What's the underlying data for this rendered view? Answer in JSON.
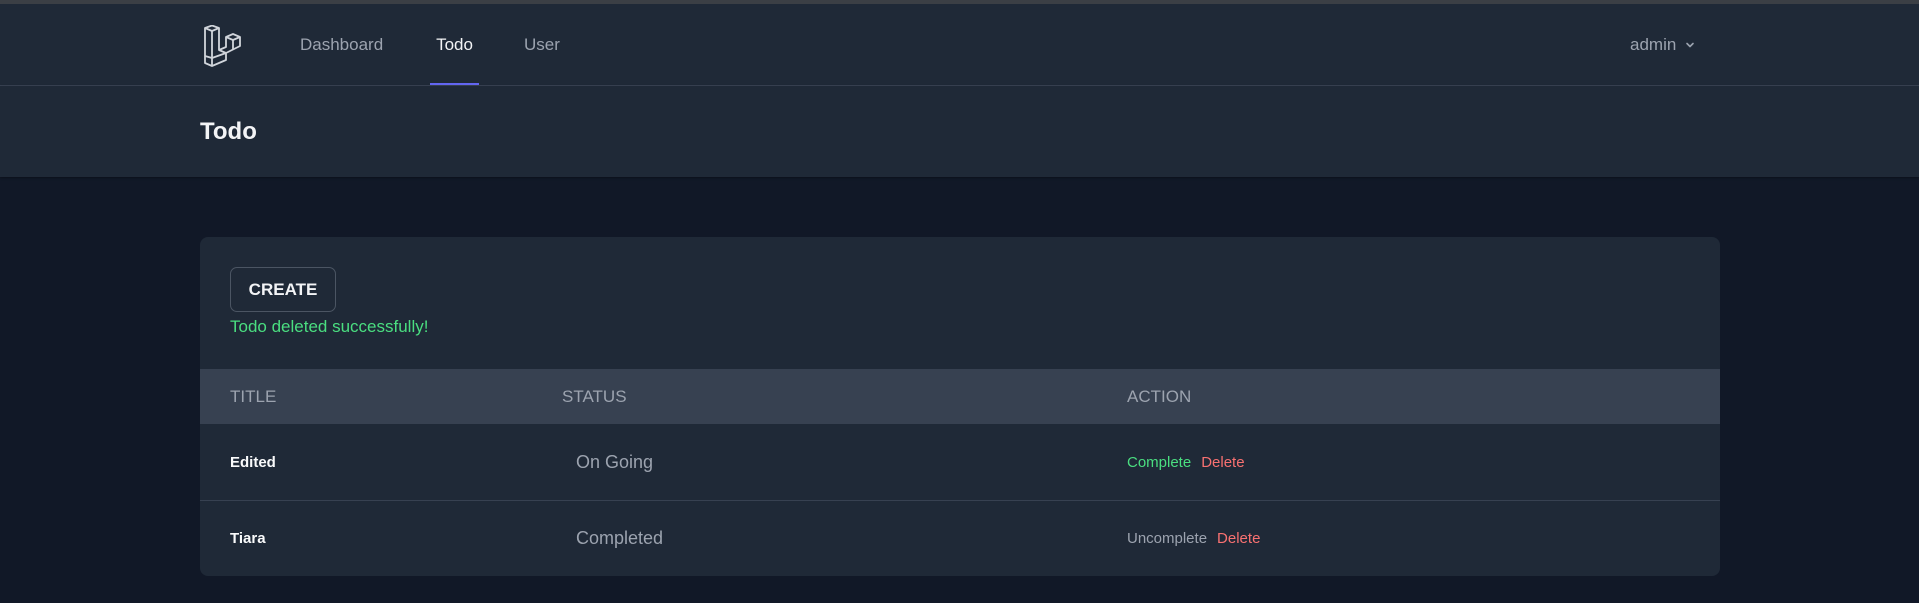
{
  "nav": {
    "logo": "laravel-logo-icon",
    "links": [
      {
        "label": "Dashboard"
      },
      {
        "label": "Todo",
        "active": true
      },
      {
        "label": "User"
      }
    ],
    "user_label": "admin",
    "accent_color": "#6366f1"
  },
  "header": {
    "title": "Todo"
  },
  "main": {
    "create_label": "CREATE",
    "flash_message": "Todo deleted successfully!",
    "flash_color": "#4ade80",
    "columns": [
      "TITLE",
      "STATUS",
      "ACTION"
    ],
    "rows": [
      {
        "title": "Edited",
        "status": "On Going",
        "toggle_action": "Complete",
        "delete_action": "Delete"
      },
      {
        "title": "Tiara",
        "status": "Completed",
        "toggle_action": "Uncomplete",
        "delete_action": "Delete"
      }
    ]
  }
}
